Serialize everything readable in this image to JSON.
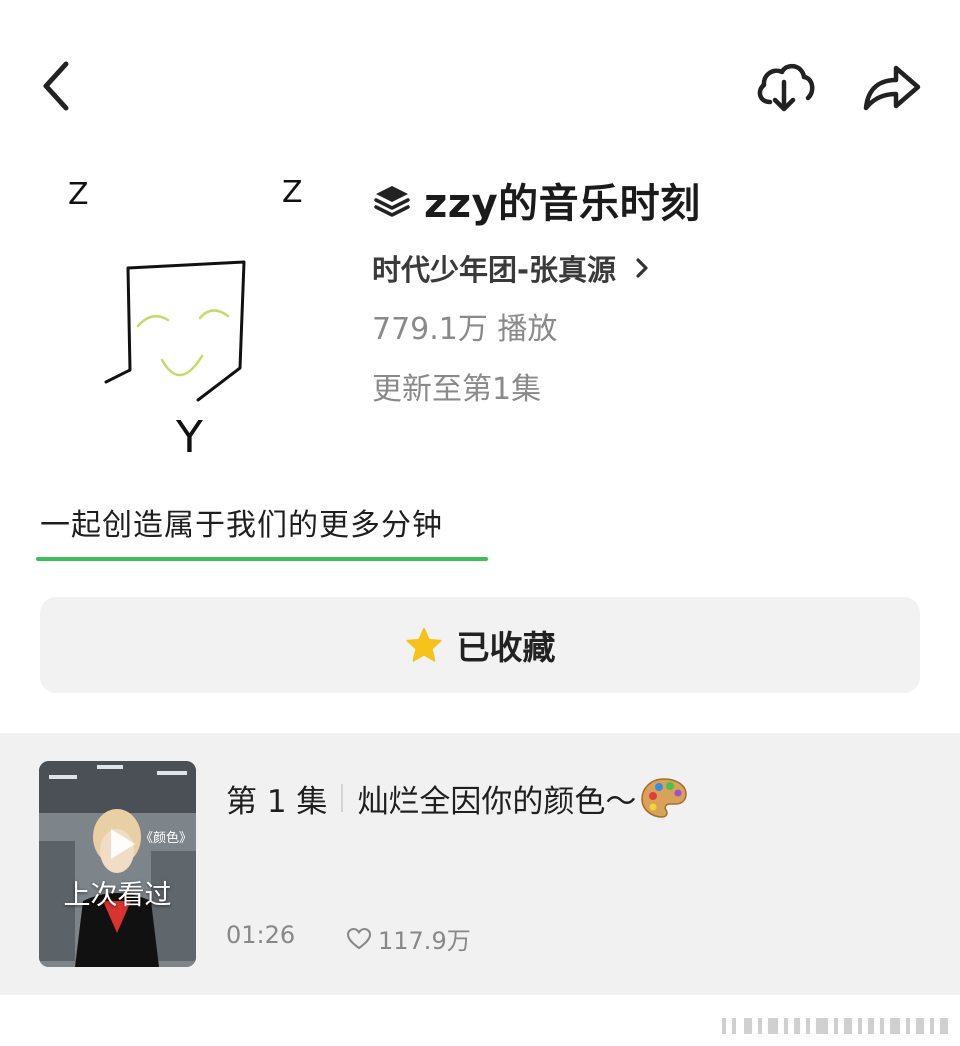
{
  "header": {
    "back_icon": "chevron-left-icon",
    "download_icon": "cloud-download-icon",
    "share_icon": "share-arrow-icon"
  },
  "album": {
    "cover_letters": [
      "Z",
      "Z",
      "Y"
    ],
    "title": "zzy的音乐时刻",
    "title_icon": "layers-icon",
    "author": "时代少年团-张真源",
    "plays": "779.1万 播放",
    "update_status": "更新至第1集"
  },
  "tagline": "一起创造属于我们的更多分钟",
  "collect_button": {
    "label": "已收藏",
    "icon": "star-icon",
    "star_color": "#f7c21a"
  },
  "episodes": [
    {
      "number": "第 1 集",
      "title": "灿烂全因你的颜色～",
      "thumb_label": "上次看过",
      "thumb_overlay": "《颜色》",
      "duration": "01:26",
      "likes": "117.9万"
    }
  ],
  "colors": {
    "accent_green": "#3fbf5a",
    "secondary_text": "#8a8a8a",
    "button_bg": "#f2f2f2"
  }
}
